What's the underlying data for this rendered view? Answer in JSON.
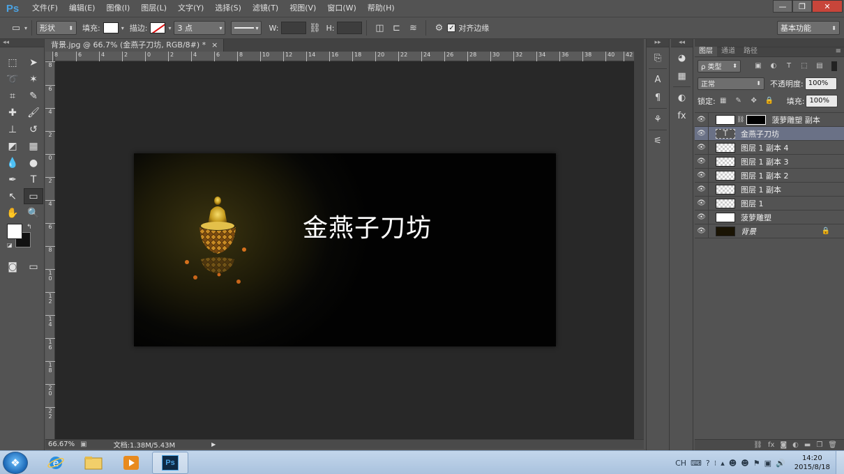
{
  "app": {
    "logo": "Ps"
  },
  "menu": [
    "文件(F)",
    "编辑(E)",
    "图像(I)",
    "图层(L)",
    "文字(Y)",
    "选择(S)",
    "滤镜(T)",
    "视图(V)",
    "窗口(W)",
    "帮助(H)"
  ],
  "window_controls": {
    "minimize": "—",
    "restore": "❐",
    "close": "✕"
  },
  "options": {
    "shape_mode": "形状",
    "fill_label": "填充:",
    "stroke_label": "描边:",
    "stroke_size": "3 点",
    "w_label": "W:",
    "h_label": "H:",
    "align_edges_label": "对齐边缘",
    "workspace": "基本功能"
  },
  "toolbar": {
    "collapse": "◂◂"
  },
  "document": {
    "tab_title": "背景.jpg @ 66.7% (金燕子刀坊, RGB/8#) *",
    "tab_close": "×",
    "image_text": "金燕子刀坊",
    "ruler_h": [
      "8",
      "6",
      "4",
      "2",
      "0",
      "2",
      "4",
      "6",
      "8",
      "10",
      "12",
      "14",
      "16",
      "18",
      "20",
      "22",
      "24",
      "26",
      "28",
      "30",
      "32",
      "34",
      "36",
      "38",
      "40",
      "42"
    ],
    "ruler_v": [
      "8",
      "6",
      "4",
      "2",
      "0",
      "2",
      "4",
      "6",
      "8",
      "1\n0",
      "1\n2",
      "1\n4",
      "1\n6",
      "1\n8",
      "2\n0",
      "2\n2"
    ]
  },
  "status": {
    "zoom": "66.67%",
    "doc_info": "文档:1.38M/5.43M"
  },
  "layers_panel": {
    "tabs": [
      "图层",
      "通道",
      "路径"
    ],
    "filter_kind": "ρ 类型",
    "blend_mode": "正常",
    "opacity_label": "不透明度:",
    "opacity_value": "100%",
    "lock_label": "锁定:",
    "fill_label": "填充:",
    "fill_value": "100%",
    "layers": [
      {
        "name": "菠萝雕塑 副本",
        "type": "smart-mask"
      },
      {
        "name": "金燕子刀坊",
        "type": "text",
        "selected": true
      },
      {
        "name": "图层 1 副本 4",
        "type": "pixel"
      },
      {
        "name": "图层 1 副本 3",
        "type": "pixel"
      },
      {
        "name": "图层 1 副本 2",
        "type": "pixel"
      },
      {
        "name": "图层 1 副本",
        "type": "pixel"
      },
      {
        "name": "图层 1",
        "type": "pixel"
      },
      {
        "name": "菠萝雕塑",
        "type": "smart"
      },
      {
        "name": "背景",
        "type": "background",
        "locked": true
      }
    ],
    "footer_icons": [
      "link-icon",
      "fx-icon",
      "mask-icon",
      "adjustment-icon",
      "folder-icon",
      "new-layer-icon",
      "trash-icon"
    ]
  },
  "taskbar": {
    "apps": [
      "internet-explorer",
      "file-explorer",
      "media-player",
      "photoshop"
    ],
    "ps_icon": "Ps",
    "language": "CH",
    "time": "14:20",
    "date": "2015/8/18"
  },
  "colors": {
    "accent": "#4ba3e3",
    "panel": "#535353",
    "selected_layer": "#6a7186"
  }
}
